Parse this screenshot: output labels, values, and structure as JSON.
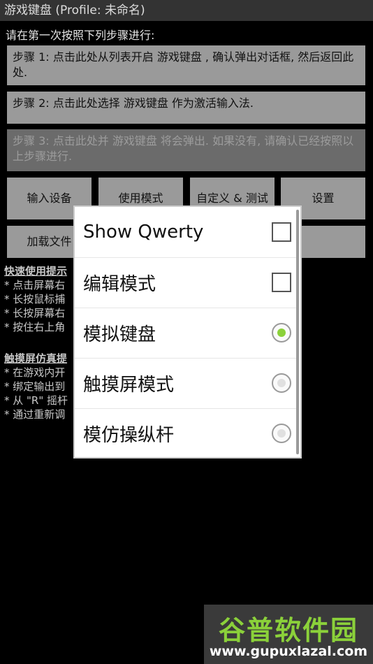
{
  "title_bar": "游戏键盘 (Profile: 未命名)",
  "intro_text": "请在第一次按照下列步骤进行:",
  "steps": [
    {
      "text": "步骤 1: 点击此处从列表开启 游戏键盘 , 确认弹出对话框, 然后返回此处."
    },
    {
      "text": "步骤 2: 点击此处选择 游戏键盘 作为激活输入法."
    },
    {
      "text": "步骤 3: 点击此处并 游戏键盘 将会弹出. 如果没有, 请确认已经按照以上步骤进行."
    }
  ],
  "buttons_row1": [
    "输入设备",
    "使用模式",
    "自定义 & 测试",
    "设置"
  ],
  "buttons_row2": [
    "加载文件"
  ],
  "quick_tips": {
    "heading": "快速使用提示",
    "lines": [
      "* 点击屏幕右",
      "* 长按鼠标捕",
      "* 长按屏幕右",
      "* 按住右上角"
    ]
  },
  "touch_tips": {
    "heading": "触摸屏仿真提",
    "lines": [
      "* 在游戏内开",
      "* 绑定输出到",
      "* 从 \"R\" 摇杆",
      "* 通过重新调"
    ]
  },
  "dialog": {
    "options": [
      {
        "label": "Show Qwerty",
        "control": "checkbox",
        "checked": false
      },
      {
        "label": "编辑模式",
        "control": "checkbox",
        "checked": false
      },
      {
        "label": "模拟键盘",
        "control": "radio",
        "checked": true
      },
      {
        "label": "触摸屏模式",
        "control": "radio",
        "checked": false
      },
      {
        "label": "模仿操纵杆",
        "control": "radio",
        "checked": false
      }
    ]
  },
  "watermark": {
    "logo": "谷普软件园",
    "url": "www.gupuxlazal.com"
  },
  "colors": {
    "radio_selected": "#8bd13a",
    "radio_unselected": "#cccccc",
    "button_bg": "#9a9a9a"
  }
}
